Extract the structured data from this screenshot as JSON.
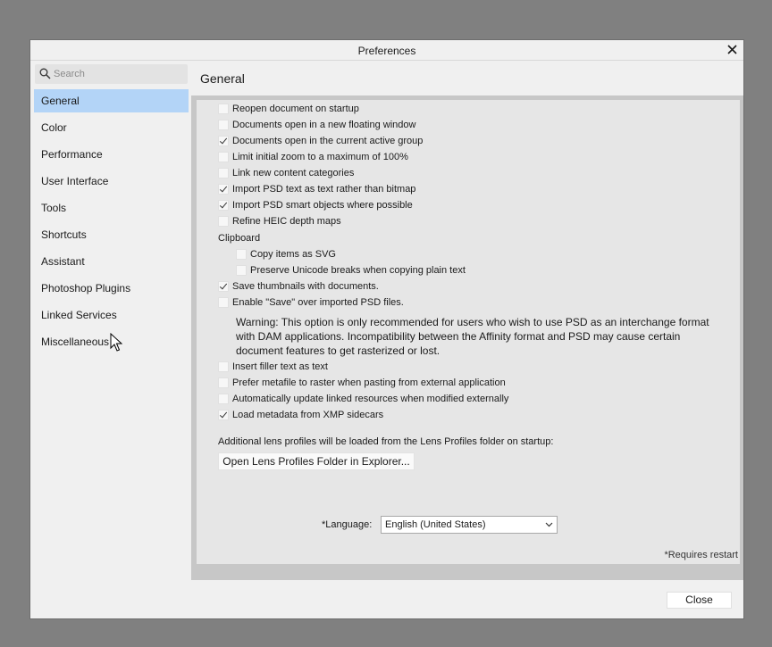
{
  "window": {
    "title": "Preferences"
  },
  "search": {
    "placeholder": "Search"
  },
  "nav": [
    {
      "label": "General",
      "active": true
    },
    {
      "label": "Color"
    },
    {
      "label": "Performance"
    },
    {
      "label": "User Interface"
    },
    {
      "label": "Tools"
    },
    {
      "label": "Shortcuts"
    },
    {
      "label": "Assistant"
    },
    {
      "label": "Photoshop Plugins"
    },
    {
      "label": "Linked Services"
    },
    {
      "label": "Miscellaneous"
    }
  ],
  "page": {
    "title": "General"
  },
  "options": {
    "reopen": {
      "label": "Reopen document on startup",
      "checked": false
    },
    "floating": {
      "label": "Documents open in a new floating window",
      "checked": false
    },
    "active_group": {
      "label": "Documents open in the current active group",
      "checked": true
    },
    "zoom": {
      "label": "Limit initial zoom to a maximum of 100%",
      "checked": false
    },
    "link_categories": {
      "label": "Link new content categories",
      "checked": false
    },
    "psd_text": {
      "label": "Import PSD text as text rather than bitmap",
      "checked": true
    },
    "psd_smart": {
      "label": "Import PSD smart objects where possible",
      "checked": true
    },
    "heic": {
      "label": "Refine HEIC depth maps",
      "checked": false
    },
    "clipboard_label": "Clipboard",
    "copy_svg": {
      "label": "Copy items as SVG",
      "checked": false
    },
    "unicode": {
      "label": "Preserve Unicode breaks when copying plain text",
      "checked": false
    },
    "thumbnails": {
      "label": "Save thumbnails with documents.",
      "checked": true
    },
    "enable_save": {
      "label": "Enable \"Save\" over imported PSD files.",
      "checked": false
    },
    "warning": "Warning: This option is only recommended for users who wish to use PSD as an interchange format with DAM applications. Incompatibility between the Affinity format and PSD may cause certain document features to get rasterized or lost.",
    "filler": {
      "label": "Insert filler text as text",
      "checked": false
    },
    "metafile": {
      "label": "Prefer metafile to raster when pasting from external application",
      "checked": false
    },
    "auto_update": {
      "label": "Automatically update linked resources when modified externally",
      "checked": false
    },
    "xmp": {
      "label": "Load metadata from XMP sidecars",
      "checked": true
    }
  },
  "lens": {
    "info": "Additional lens profiles will be loaded from the Lens Profiles folder on startup:",
    "button": "Open Lens Profiles Folder in Explorer..."
  },
  "language": {
    "label": "*Language:",
    "value": "English (United States)"
  },
  "restart_note": "*Requires restart",
  "footer": {
    "close": "Close"
  },
  "colors": {
    "selected_nav": "#b3d4f7",
    "backdrop": "#808080",
    "dialog": "#f0f0f0",
    "panel": "#e6e6e6"
  }
}
